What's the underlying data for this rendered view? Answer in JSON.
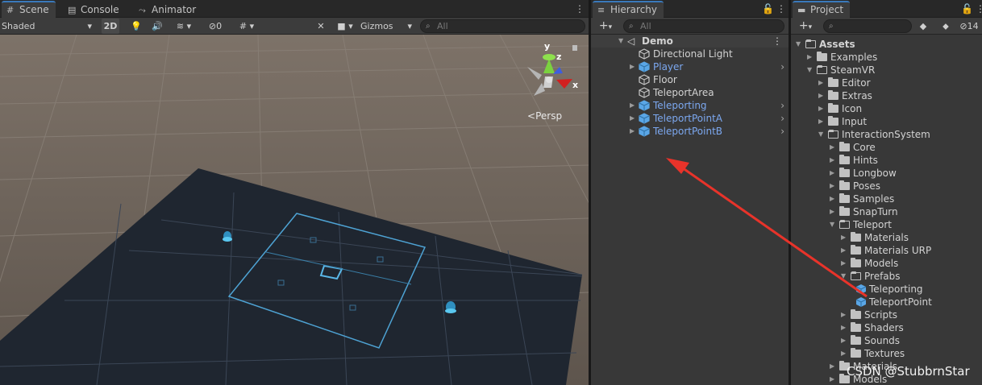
{
  "scene": {
    "tabs": [
      {
        "label": "Scene",
        "icon": "grid-icon"
      },
      {
        "label": "Console",
        "icon": "console-icon"
      },
      {
        "label": "Animator",
        "icon": "animator-icon"
      }
    ],
    "shading_mode": "Shaded",
    "mode_2d": "2D",
    "hidden_count": "0",
    "gizmos_label": "Gizmos",
    "search_placeholder": "All",
    "view_label": "Persp",
    "axes": {
      "y": "y",
      "z": "z",
      "x": "x"
    }
  },
  "hierarchy": {
    "tab_label": "Hierarchy",
    "search_placeholder": "All",
    "scene_name": "Demo",
    "items": [
      {
        "label": "Directional Light",
        "prefab": false,
        "expandable": false
      },
      {
        "label": "Player",
        "prefab": true,
        "expandable": true
      },
      {
        "label": "Floor",
        "prefab": false,
        "expandable": false
      },
      {
        "label": "TeleportArea",
        "prefab": false,
        "expandable": false
      },
      {
        "label": "Teleporting",
        "prefab": true,
        "expandable": true
      },
      {
        "label": "TeleportPointA",
        "prefab": true,
        "expandable": true
      },
      {
        "label": "TeleportPointB",
        "prefab": true,
        "expandable": true
      }
    ]
  },
  "project": {
    "tab_label": "Project",
    "hidden_count": "14",
    "tree": [
      {
        "label": "Assets",
        "depth": 0,
        "open": true,
        "type": "folder",
        "bold": true
      },
      {
        "label": "Examples",
        "depth": 1,
        "open": false,
        "type": "folder"
      },
      {
        "label": "SteamVR",
        "depth": 1,
        "open": true,
        "type": "folder"
      },
      {
        "label": "Editor",
        "depth": 2,
        "open": false,
        "type": "folder"
      },
      {
        "label": "Extras",
        "depth": 2,
        "open": false,
        "type": "folder"
      },
      {
        "label": "Icon",
        "depth": 2,
        "open": false,
        "type": "folder"
      },
      {
        "label": "Input",
        "depth": 2,
        "open": false,
        "type": "folder"
      },
      {
        "label": "InteractionSystem",
        "depth": 2,
        "open": true,
        "type": "folder"
      },
      {
        "label": "Core",
        "depth": 3,
        "open": false,
        "type": "folder"
      },
      {
        "label": "Hints",
        "depth": 3,
        "open": false,
        "type": "folder"
      },
      {
        "label": "Longbow",
        "depth": 3,
        "open": false,
        "type": "folder"
      },
      {
        "label": "Poses",
        "depth": 3,
        "open": false,
        "type": "folder"
      },
      {
        "label": "Samples",
        "depth": 3,
        "open": false,
        "type": "folder"
      },
      {
        "label": "SnapTurn",
        "depth": 3,
        "open": false,
        "type": "folder"
      },
      {
        "label": "Teleport",
        "depth": 3,
        "open": true,
        "type": "folder"
      },
      {
        "label": "Materials",
        "depth": 4,
        "open": false,
        "type": "folder"
      },
      {
        "label": "Materials URP",
        "depth": 4,
        "open": false,
        "type": "folder"
      },
      {
        "label": "Models",
        "depth": 4,
        "open": false,
        "type": "folder"
      },
      {
        "label": "Prefabs",
        "depth": 4,
        "open": true,
        "type": "folder"
      },
      {
        "label": "Teleporting",
        "depth": 5,
        "open": false,
        "type": "prefab"
      },
      {
        "label": "TeleportPoint",
        "depth": 5,
        "open": false,
        "type": "prefab"
      },
      {
        "label": "Scripts",
        "depth": 4,
        "open": false,
        "type": "folder"
      },
      {
        "label": "Shaders",
        "depth": 4,
        "open": false,
        "type": "folder"
      },
      {
        "label": "Sounds",
        "depth": 4,
        "open": false,
        "type": "folder"
      },
      {
        "label": "Textures",
        "depth": 4,
        "open": false,
        "type": "folder"
      },
      {
        "label": "Materials",
        "depth": 3,
        "open": false,
        "type": "folder"
      },
      {
        "label": "Models",
        "depth": 3,
        "open": false,
        "type": "folder"
      }
    ]
  },
  "watermark": "CSDN @StubbrnStar",
  "colors": {
    "accent": "#3a79bb",
    "prefab_text": "#7ca8f0",
    "prefab_icon": "#5aa6e6",
    "annotation_arrow": "#e8332a"
  }
}
